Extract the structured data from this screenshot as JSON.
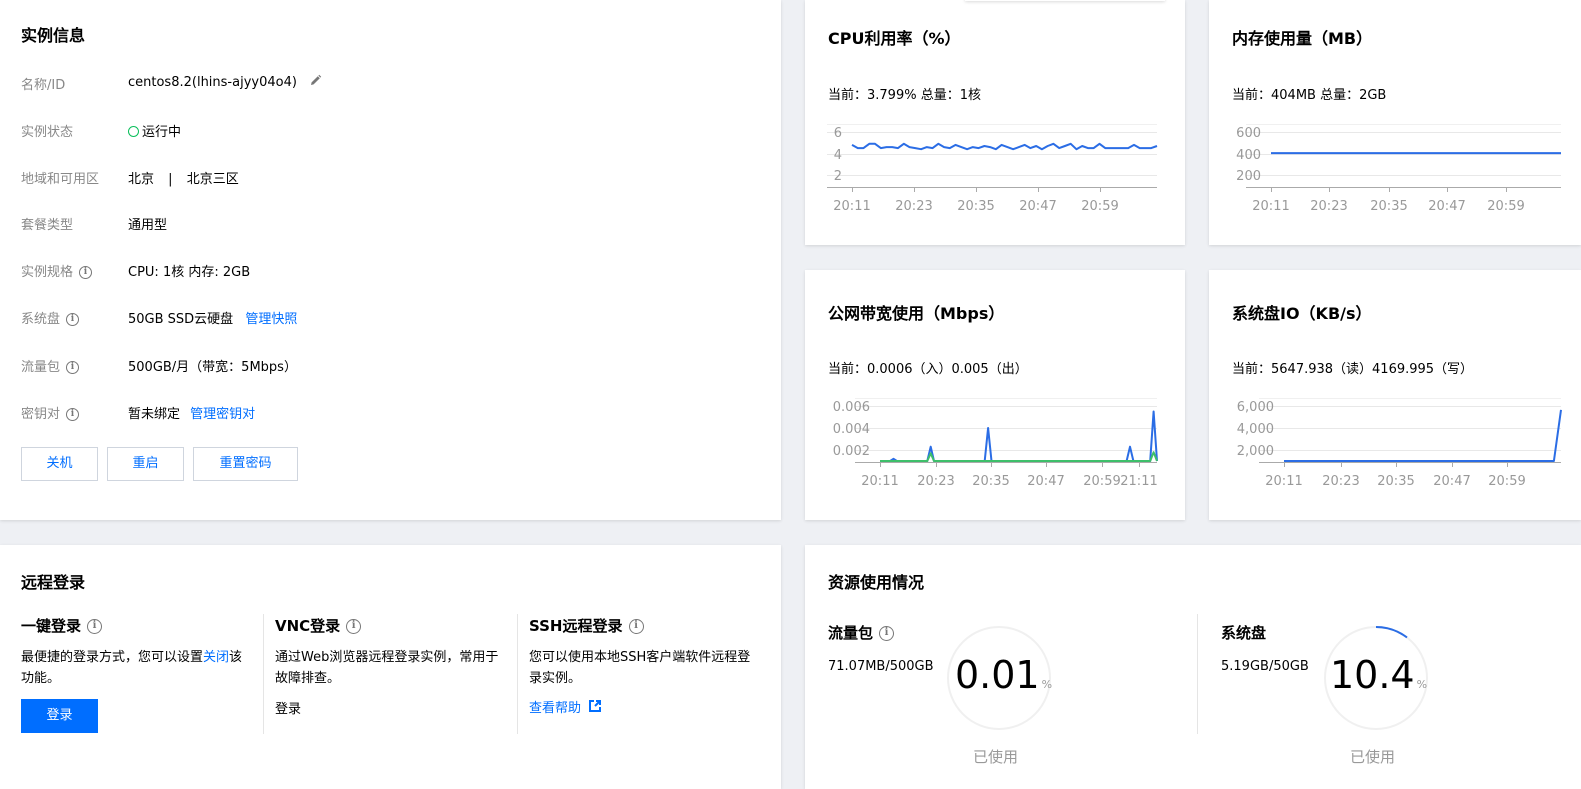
{
  "instance": {
    "title": "实例信息",
    "rows": [
      {
        "label": "名称/ID",
        "value": "centos8.2(lhins-ajyy04o4)"
      },
      {
        "label": "实例状态",
        "value": "运行中"
      },
      {
        "label": "地域和可用区",
        "region": "北京",
        "zone": "北京三区",
        "sep": "|"
      },
      {
        "label": "套餐类型",
        "value": "通用型"
      },
      {
        "label": "实例规格",
        "value": "CPU: 1核 内存: 2GB"
      },
      {
        "label": "系统盘",
        "value": "50GB SSD云硬盘",
        "link": "管理快照"
      },
      {
        "label": "流量包",
        "value": "500GB/月（带宽：5Mbps）"
      },
      {
        "label": "密钥对",
        "value": "暂未绑定",
        "link": "管理密钥对"
      }
    ],
    "buttons": {
      "shutdown": "关机",
      "restart": "重启",
      "reset_password": "重置密码"
    },
    "status_color": "#0abf5b"
  },
  "metrics": {
    "cpu": {
      "title": "CPU利用率（%）",
      "current": "当前：3.799% 总量：1核"
    },
    "mem": {
      "title": "内存使用量（MB）",
      "current": "当前：404MB 总量：2GB"
    },
    "bandwidth": {
      "title": "公网带宽使用（Mbps）",
      "current": "当前：0.0006（入）0.005（出）"
    },
    "disk_io": {
      "title": "系统盘IO（KB/s）",
      "current": "当前：5647.938（读）4169.995（写）"
    }
  },
  "chart_data": [
    {
      "type": "line",
      "name": "cpu",
      "x_ticks": [
        "20:11",
        "20:23",
        "20:35",
        "20:47",
        "20:59"
      ],
      "y_ticks": [
        "6",
        "4",
        "2"
      ],
      "ylim": [
        1,
        7
      ],
      "grid": true,
      "series": [
        {
          "color": "#2b6de5",
          "values": [
            4.8,
            4.5,
            4.5,
            4.9,
            4.9,
            4.5,
            4.6,
            4.6,
            4.5,
            4.9,
            4.6,
            4.5,
            4.4,
            4.6,
            4.5,
            4.9,
            4.6,
            4.5,
            4.8,
            4.6,
            4.4,
            4.6,
            4.5,
            4.7,
            4.6,
            4.4,
            4.8,
            4.6,
            4.4,
            4.6,
            4.8,
            4.5,
            4.7,
            4.4,
            4.7,
            4.9,
            4.5,
            4.7,
            4.9,
            4.4,
            4.7,
            4.5,
            4.5,
            4.9,
            4.5,
            4.5,
            4.5,
            4.5,
            4.5,
            4.8,
            4.5,
            4.5,
            4.5,
            4.7
          ]
        }
      ]
    },
    {
      "type": "line",
      "name": "memory",
      "x_ticks": [
        "20:11",
        "20:23",
        "20:35",
        "20:47",
        "20:59"
      ],
      "y_ticks": [
        "600",
        "400",
        "200"
      ],
      "ylim": [
        100,
        700
      ],
      "grid": true,
      "series": [
        {
          "color": "#2b6de5",
          "values": [
            404,
            404,
            404,
            404,
            404,
            404,
            404,
            404,
            404,
            404,
            404,
            404,
            404,
            404,
            404,
            404,
            404,
            404,
            404,
            404
          ]
        }
      ]
    },
    {
      "type": "line",
      "name": "bandwidth",
      "x_ticks": [
        "20:11",
        "20:23",
        "20:35",
        "20:47",
        "20:59",
        "21:11"
      ],
      "y_ticks": [
        "0.006",
        "0.004",
        "0.002"
      ],
      "ylim": [
        0,
        0.007
      ],
      "grid": true,
      "series": [
        {
          "name": "出",
          "color": "#2b6de5",
          "values": [
            0.0003,
            0.0003,
            0.0003,
            0.0003,
            0.0012,
            0.0003,
            0.0003,
            0.0003,
            0.0003,
            0.0003,
            0.0003,
            0.0003,
            0.0003,
            0.0003,
            0.0003,
            0.0023,
            0.0003,
            0.0003,
            0.0003,
            0.0003,
            0.0003,
            0.0003,
            0.0003,
            0.0003,
            0.0003,
            0.0003,
            0.0003,
            0.0003,
            0.0003,
            0.0003,
            0.0003,
            0.0003,
            0.004,
            0.0003,
            0.0003,
            0.0003,
            0.0003,
            0.0003,
            0.0003,
            0.0003,
            0.0003,
            0.0003,
            0.0003,
            0.0003,
            0.0003,
            0.0003,
            0.0003,
            0.0003,
            0.0003,
            0.0003,
            0.0003,
            0.0003,
            0.0003,
            0.0003,
            0.0003,
            0.0003,
            0.0003,
            0.0003,
            0.0003,
            0.0003,
            0.0003,
            0.0003,
            0.0003,
            0.0003,
            0.0003,
            0.0003,
            0.0003,
            0.0003,
            0.0003,
            0.0003,
            0.0003,
            0.0003,
            0.0003,
            0.0003,
            0.0023,
            0.0003,
            0.0003,
            0.0003,
            0.0003,
            0.0003,
            0.0005,
            0.0055,
            0.0003
          ]
        },
        {
          "name": "入",
          "color": "#3ebf6a",
          "values": [
            0.0002,
            0.0003,
            0.0002,
            0.0004,
            0.0002,
            0.0003,
            0.0002,
            0.0004,
            0.0003,
            0.0002,
            0.0004,
            0.0003,
            0.0002,
            0.0004,
            0.0003,
            0.0017,
            0.0003,
            0.0002,
            0.0004,
            0.0003,
            0.0002,
            0.0004,
            0.0003,
            0.0002,
            0.0004,
            0.0003,
            0.0002,
            0.0004,
            0.0003,
            0.0002,
            0.0004,
            0.0003,
            0.0005,
            0.0002,
            0.0004,
            0.0003,
            0.0002,
            0.0004,
            0.0003,
            0.0002,
            0.0004,
            0.0003,
            0.0002,
            0.0004,
            0.0003,
            0.0002,
            0.0004,
            0.0003,
            0.0002,
            0.0004,
            0.0003,
            0.0002,
            0.0004,
            0.0003,
            0.0002,
            0.0004,
            0.0003,
            0.0002,
            0.0004,
            0.0003,
            0.0002,
            0.0004,
            0.0003,
            0.0002,
            0.0004,
            0.0003,
            0.0002,
            0.0004,
            0.0003,
            0.0002,
            0.0004,
            0.0003,
            0.0002,
            0.0004,
            0.0008,
            0.0003,
            0.0002,
            0.0004,
            0.0003,
            0.0002,
            0.0006,
            0.0018,
            0.0002
          ]
        }
      ]
    },
    {
      "type": "line",
      "name": "disk_io",
      "x_ticks": [
        "20:11",
        "20:23",
        "20:35",
        "20:47",
        "20:59"
      ],
      "y_ticks": [
        "6,000",
        "4,000",
        "2,000"
      ],
      "ylim": [
        0,
        7000
      ],
      "grid": true,
      "series": [
        {
          "color": "#2b6de5",
          "values": [
            0,
            0,
            0,
            0,
            0,
            0,
            0,
            0,
            0,
            0,
            0,
            0,
            0,
            0,
            0,
            0,
            0,
            0,
            0,
            0,
            0,
            0,
            0,
            0,
            0,
            0,
            0,
            0,
            0,
            0,
            0,
            0,
            0,
            0,
            0,
            0,
            0,
            0,
            0,
            5647.938
          ]
        }
      ]
    }
  ],
  "remote": {
    "title": "远程登录",
    "one_click": {
      "title": "一键登录",
      "desc1": "最便捷的登录方式，您可以设置",
      "desc_link": "关闭",
      "desc2": "该功能。",
      "button": "登录"
    },
    "vnc": {
      "title": "VNC登录",
      "desc": "通过Web浏览器远程登录实例，常用于故障排查。",
      "link": "登录"
    },
    "ssh": {
      "title": "SSH远程登录",
      "desc": "您可以使用本地SSH客户端软件远程登录实例。",
      "link": "查看帮助"
    }
  },
  "resources": {
    "title": "资源使用情况",
    "traffic": {
      "title": "流量包",
      "amount": "71.07MB/500GB",
      "percent": "0.01",
      "unit": "%",
      "used": "已使用",
      "fraction": 0.0001
    },
    "disk": {
      "title": "系统盘",
      "amount": "5.19GB/50GB",
      "percent": "10.4",
      "unit": "%",
      "used": "已使用",
      "fraction": 0.104
    }
  }
}
